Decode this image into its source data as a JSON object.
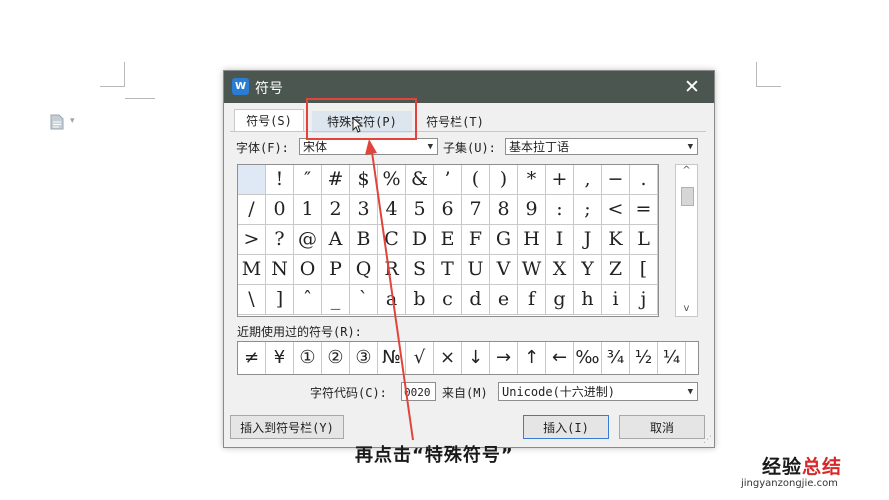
{
  "dialog": {
    "title": "符号",
    "close_glyph": "✕",
    "app_icon_glyph": "W"
  },
  "tabs": [
    {
      "label": "符号(S)"
    },
    {
      "label": "特殊字符(P)"
    },
    {
      "label": "符号栏(T)"
    }
  ],
  "font": {
    "label": "字体(F):",
    "value": "宋体"
  },
  "subset": {
    "label": "子集(U):",
    "value": "基本拉丁语"
  },
  "symbols": [
    "",
    "!",
    "″",
    "#",
    "$",
    "%",
    "&",
    "’",
    "(",
    ")",
    "*",
    "+",
    ",",
    "−",
    ".",
    "/",
    "0",
    "1",
    "2",
    "3",
    "4",
    "5",
    "6",
    "7",
    "8",
    "9",
    ":",
    ";",
    "<",
    "=",
    ">",
    "?",
    "@",
    "A",
    "B",
    "C",
    "D",
    "E",
    "F",
    "G",
    "H",
    "I",
    "J",
    "K",
    "L",
    "M",
    "N",
    "O",
    "P",
    "Q",
    "R",
    "S",
    "T",
    "U",
    "V",
    "W",
    "X",
    "Y",
    "Z",
    "[",
    "\\",
    "]",
    "ˆ",
    "_",
    "`",
    "a",
    "b",
    "c",
    "d",
    "e",
    "f",
    "g",
    "h",
    "i",
    "j"
  ],
  "recent": {
    "label": "近期使用过的符号(R):",
    "items": [
      "≠",
      "¥",
      "①",
      "②",
      "③",
      "№",
      "√",
      "×",
      "↓",
      "→",
      "↑",
      "←",
      "‰",
      "¾",
      "½",
      "¼"
    ]
  },
  "char_code": {
    "label": "字符代码(C):",
    "value": "0020"
  },
  "from": {
    "label": "来自(M)",
    "value": "Unicode(十六进制)"
  },
  "buttons": {
    "insert_to_bar": "插入到符号栏(Y)",
    "insert": "插入(I)",
    "cancel": "取消"
  },
  "caption": "再点击“特殊符号”",
  "watermark": {
    "main_part1": "经验",
    "main_part2": "总结",
    "site": "jingyanzongjie.com"
  },
  "colors": {
    "highlight": "#e0443c",
    "titlebar": "#4c5650",
    "selection": "#dfe9f5"
  }
}
